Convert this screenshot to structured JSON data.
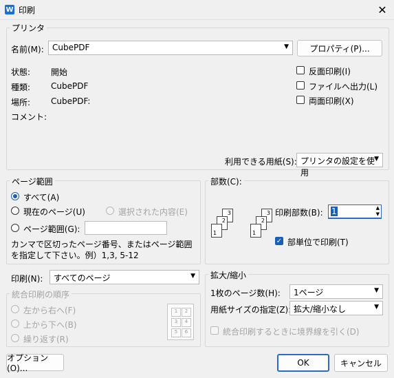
{
  "title_bar": {
    "app_icon": "W",
    "title": "印刷",
    "close": "✕"
  },
  "printer": {
    "legend": "プリンタ",
    "name_label": "名前(M):",
    "name_value": "CubePDF",
    "properties_button": "プロパティ(P)...",
    "status_label": "状態:",
    "status_value": "開始",
    "type_label": "種類:",
    "type_value": "CubePDF",
    "location_label": "場所:",
    "location_value": "CubePDF:",
    "comment_label": "コメント:",
    "reverse_print": "反面印刷(I)",
    "print_to_file": "ファイルへ出力(L)",
    "duplex": "両面印刷(X)",
    "paper_label": "利用できる用紙(S):",
    "paper_value": "プリンタの設定を使用"
  },
  "page_range": {
    "legend": "ページ範囲",
    "all": "すべて(A)",
    "current": "現在のページ(U)",
    "selection": "選択された内容(E)",
    "pages": "ページ範囲(G):",
    "help": "カンマで区切ったページ番号、またはページ範囲を指定して下さい。例）1,3, 5-12"
  },
  "copies": {
    "legend": "部数(C):",
    "count_label": "印刷部数(B):",
    "count_value": "1",
    "collate": "部単位で印刷(T)"
  },
  "print_what": {
    "label": "印刷(N):",
    "value": "すべてのページ"
  },
  "order": {
    "legend": "統合印刷の順序",
    "left_to_right": "左から右へ(F)",
    "top_to_bottom": "上から下へ(B)",
    "repeat": "繰り返す(R)",
    "grid": [
      "1",
      "2",
      "3",
      "4",
      "5",
      "6"
    ]
  },
  "zoom": {
    "legend": "拡大/縮小",
    "pages_per_sheet_label": "1枚のページ数(H):",
    "pages_per_sheet_value": "1ページ",
    "scale_label": "用紙サイズの指定(Z):",
    "scale_value": "拡大/縮小なし",
    "border": "統合印刷するときに境界線を引く(D)"
  },
  "footer": {
    "options": "オプション(O)...",
    "ok": "OK",
    "cancel": "キャンセル"
  }
}
